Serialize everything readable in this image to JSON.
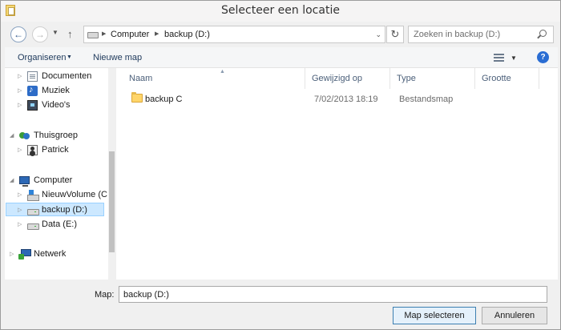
{
  "window": {
    "title": "Selecteer een locatie"
  },
  "nav": {
    "back": "←",
    "forward": "→",
    "up": "↑",
    "refresh": "↻"
  },
  "address": {
    "segments": [
      "Computer",
      "backup (D:)"
    ]
  },
  "search": {
    "placeholder": "Zoeken in backup (D:)"
  },
  "toolbar": {
    "organize": "Organiseren",
    "new_folder": "Nieuwe map",
    "help": "?"
  },
  "sidebar": {
    "items": [
      {
        "label": "Documenten",
        "icon": "documents-icon"
      },
      {
        "label": "Muziek",
        "icon": "music-icon"
      },
      {
        "label": "Video's",
        "icon": "videos-icon"
      },
      {
        "label": "Thuisgroep",
        "icon": "homegroup-icon"
      },
      {
        "label": "Patrick",
        "icon": "user-icon"
      },
      {
        "label": "Computer",
        "icon": "computer-icon"
      },
      {
        "label": "NieuwVolume (C",
        "icon": "windows-drive-icon"
      },
      {
        "label": "backup (D:)",
        "icon": "drive-icon",
        "selected": true
      },
      {
        "label": "Data (E:)",
        "icon": "drive-icon"
      },
      {
        "label": "Netwerk",
        "icon": "network-icon"
      }
    ]
  },
  "files": {
    "columns": [
      "Naam",
      "Gewijzigd op",
      "Type",
      "Grootte"
    ],
    "rows": [
      {
        "name": "backup C",
        "modified": "7/02/2013 18:19",
        "type": "Bestandsmap",
        "size": ""
      }
    ]
  },
  "footer": {
    "map_label": "Map:",
    "map_value": "backup (D:)",
    "select_button": "Map selecteren",
    "cancel_button": "Annuleren"
  },
  "colors": {
    "selection": "#cce8ff",
    "toolbar_text": "#1e395b",
    "help": "#2a6dd3"
  }
}
